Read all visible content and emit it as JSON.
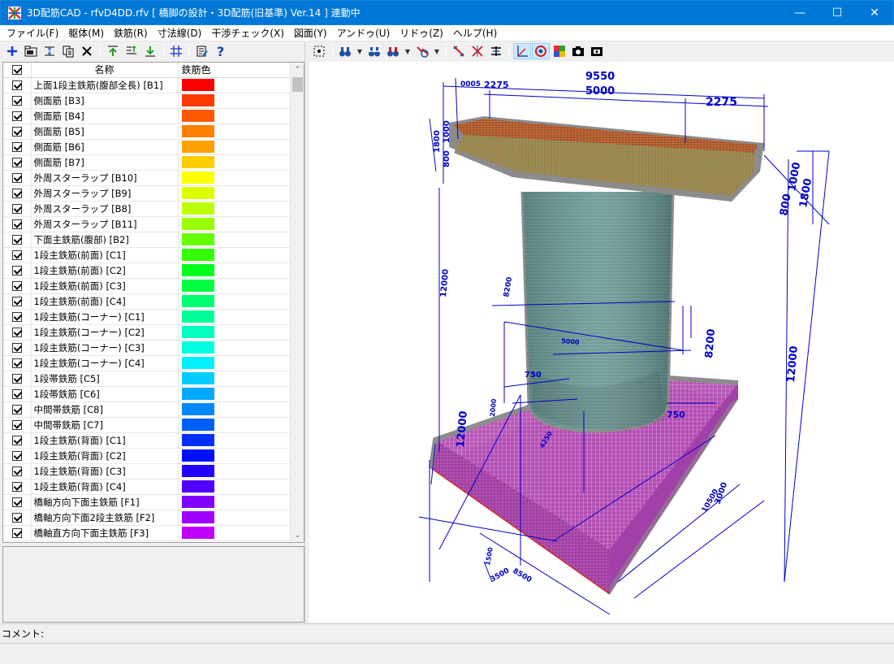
{
  "window": {
    "title": "3D配筋CAD - rfvD4DD.rfv [ 橋脚の設計・3D配筋(旧基準) Ver.14 ] 連動中",
    "minimize": "—",
    "maximize": "☐",
    "close": "✕"
  },
  "menu": [
    "ファイル(F)",
    "躯体(M)",
    "鉄筋(R)",
    "寸法線(D)",
    "干渉チェック(X)",
    "図面(Y)",
    "アンドゥ(U)",
    "リドゥ(Z)",
    "ヘルプ(H)"
  ],
  "toolbar_left_icons": [
    "add-icon",
    "open-folder-icon",
    "align-icon",
    "copy-icon",
    "delete-icon",
    "move-up-icon",
    "move-down-one-icon",
    "move-down-icon",
    "grid-icon",
    "edit-icon",
    "help-icon"
  ],
  "toolbar_right_icons": [
    "fit-view-icon",
    "binoculars-icon",
    "binoculars-select-icon",
    "binoculars-red-icon",
    "color-filter-icon",
    "rebar-red-icon",
    "rebar-cross-icon",
    "rebar-dim-icon",
    "axis-icon",
    "target-icon",
    "palette-icon",
    "camera-icon",
    "snapshot-icon"
  ],
  "table": {
    "header_check": "☑",
    "header_name": "名称",
    "header_color": "鉄筋色",
    "rows": [
      {
        "name": "上面1段主鉄筋(腹部全長) [B1]",
        "color": "#ff0000"
      },
      {
        "name": "側面筋 [B3]",
        "color": "#ff3a00"
      },
      {
        "name": "側面筋 [B4]",
        "color": "#ff5a00"
      },
      {
        "name": "側面筋 [B5]",
        "color": "#ff7f00"
      },
      {
        "name": "側面筋 [B6]",
        "color": "#ffa000"
      },
      {
        "name": "側面筋 [B7]",
        "color": "#ffcc00"
      },
      {
        "name": "外周スターラップ [B10]",
        "color": "#ffff00"
      },
      {
        "name": "外周スターラップ [B9]",
        "color": "#ddff00"
      },
      {
        "name": "外周スターラップ [B8]",
        "color": "#bbff00"
      },
      {
        "name": "外周スターラップ [B11]",
        "color": "#99ff00"
      },
      {
        "name": "下面主鉄筋(腹部) [B2]",
        "color": "#66ff00"
      },
      {
        "name": "1段主鉄筋(前面) [C1]",
        "color": "#33ff00"
      },
      {
        "name": "1段主鉄筋(前面) [C2]",
        "color": "#00ff1a"
      },
      {
        "name": "1段主鉄筋(前面) [C3]",
        "color": "#00ff40"
      },
      {
        "name": "1段主鉄筋(前面) [C4]",
        "color": "#00ff70"
      },
      {
        "name": "1段主鉄筋(コーナー) [C1]",
        "color": "#00ff99"
      },
      {
        "name": "1段主鉄筋(コーナー) [C2]",
        "color": "#00ffc0"
      },
      {
        "name": "1段主鉄筋(コーナー) [C3]",
        "color": "#00ffe0"
      },
      {
        "name": "1段主鉄筋(コーナー) [C4]",
        "color": "#00f0ff"
      },
      {
        "name": "1段帯鉄筋 [C5]",
        "color": "#00ccff"
      },
      {
        "name": "1段帯鉄筋 [C6]",
        "color": "#00a8ff"
      },
      {
        "name": "中間帯鉄筋 [C8]",
        "color": "#0088ff"
      },
      {
        "name": "中間帯鉄筋 [C7]",
        "color": "#0060ff"
      },
      {
        "name": "1段主鉄筋(背面) [C1]",
        "color": "#0030ff"
      },
      {
        "name": "1段主鉄筋(背面) [C2]",
        "color": "#0010ff"
      },
      {
        "name": "1段主鉄筋(背面) [C3]",
        "color": "#2000ff"
      },
      {
        "name": "1段主鉄筋(背面) [C4]",
        "color": "#5000ff"
      },
      {
        "name": "橋軸方向下面主鉄筋 [F1]",
        "color": "#8000ff"
      },
      {
        "name": "橋軸方向下面2段主鉄筋 [F2]",
        "color": "#a000ff"
      },
      {
        "name": "橋軸直方向下面主鉄筋 [F3]",
        "color": "#c000ff"
      }
    ]
  },
  "status": {
    "comment_label": "コメント:"
  },
  "dimensions": {
    "d9550": "9550",
    "d5000": "5000",
    "d2275a": "2275",
    "d2275b": "2275",
    "d0005": "0005",
    "d1800a": "1800",
    "d1000a": "1000",
    "d800a": "800",
    "d1000b": "1000",
    "d800b": "800",
    "d1800b": "1800",
    "d12000a": "12000",
    "d12000b": "12000",
    "d12000c": "12000",
    "d8200a": "8200",
    "d8200b": "8200",
    "d5000b": "5000",
    "d750a": "750",
    "d750b": "750",
    "d2000": "2000",
    "d3000": "3000",
    "d4250": "4250",
    "d10500": "10500",
    "d8500": "8500",
    "d1500": "1500",
    "d3500": "3500"
  }
}
